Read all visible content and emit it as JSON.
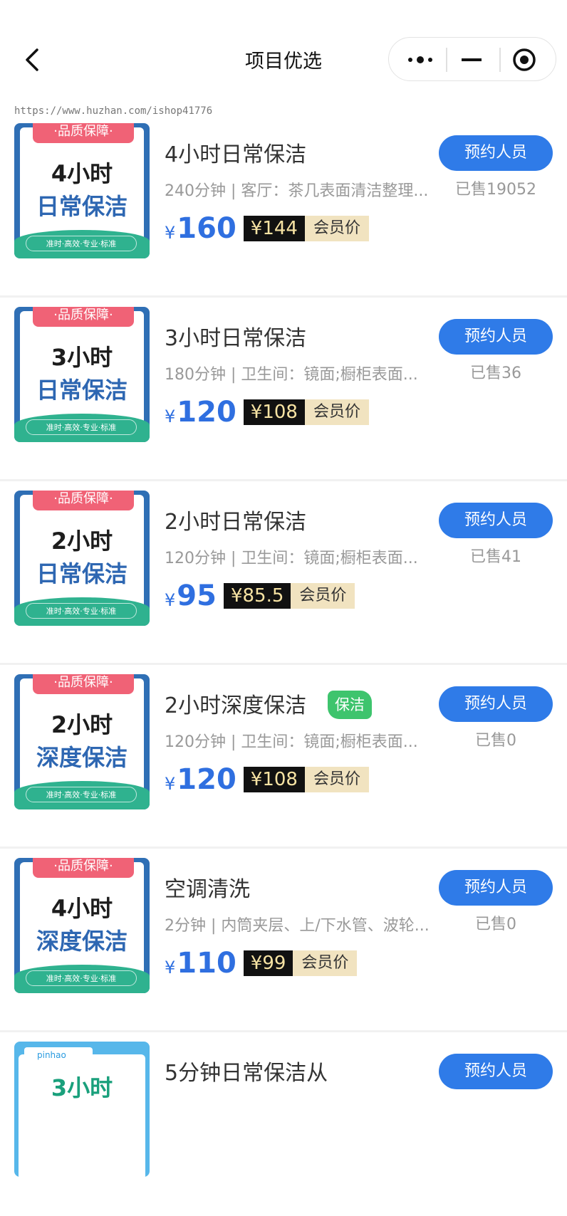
{
  "header": {
    "title": "项目优选",
    "watermark": "https://www.huzhan.com/ishop41776"
  },
  "items": [
    {
      "thumb": {
        "tag": "·品质保障·",
        "line1": "4小时",
        "line2": "日常保洁",
        "footer": "准时·高效·专业·标准"
      },
      "title": "4小时日常保洁",
      "tag": "",
      "desc": "240分钟 | 客厅：茶几表面清洁整理...",
      "price_symbol": "¥",
      "price": "160",
      "member_price": "¥144",
      "member_label": "会员价",
      "button": "预约人员",
      "sold": "已售19052"
    },
    {
      "thumb": {
        "tag": "·品质保障·",
        "line1": "3小时",
        "line2": "日常保洁",
        "footer": "准时·高效·专业·标准"
      },
      "title": "3小时日常保洁",
      "tag": "",
      "desc": "180分钟 | 卫生间：镜面;橱柜表面...",
      "price_symbol": "¥",
      "price": "120",
      "member_price": "¥108",
      "member_label": "会员价",
      "button": "预约人员",
      "sold": "已售36"
    },
    {
      "thumb": {
        "tag": "·品质保障·",
        "line1": "2小时",
        "line2": "日常保洁",
        "footer": "准时·高效·专业·标准"
      },
      "title": "2小时日常保洁",
      "tag": "",
      "desc": "120分钟 | 卫生间：镜面;橱柜表面...",
      "price_symbol": "¥",
      "price": "95",
      "member_price": "¥85.5",
      "member_label": "会员价",
      "button": "预约人员",
      "sold": "已售41"
    },
    {
      "thumb": {
        "tag": "·品质保障·",
        "line1": "2小时",
        "line2": "深度保洁",
        "footer": "准时·高效·专业·标准"
      },
      "title": "2小时深度保洁",
      "tag": "保洁",
      "desc": "120分钟 | 卫生间：镜面;橱柜表面...",
      "price_symbol": "¥",
      "price": "120",
      "member_price": "¥108",
      "member_label": "会员价",
      "button": "预约人员",
      "sold": "已售0"
    },
    {
      "thumb": {
        "tag": "·品质保障·",
        "line1": "4小时",
        "line2": "深度保洁",
        "footer": "准时·高效·专业·标准"
      },
      "title": "空调清洗",
      "tag": "",
      "desc": "2分钟 | 内筒夹层、上/下水管、波轮...",
      "price_symbol": "¥",
      "price": "110",
      "member_price": "¥99",
      "member_label": "会员价",
      "button": "预约人员",
      "sold": "已售0"
    },
    {
      "thumb": {
        "tag": "pinhao",
        "line1": "3小时",
        "line2": "",
        "footer": ""
      },
      "title": "5分钟日常保洁从",
      "tag": "",
      "desc": "",
      "price_symbol": "",
      "price": "",
      "member_price": "",
      "member_label": "",
      "button": "预约人员",
      "sold": ""
    }
  ]
}
